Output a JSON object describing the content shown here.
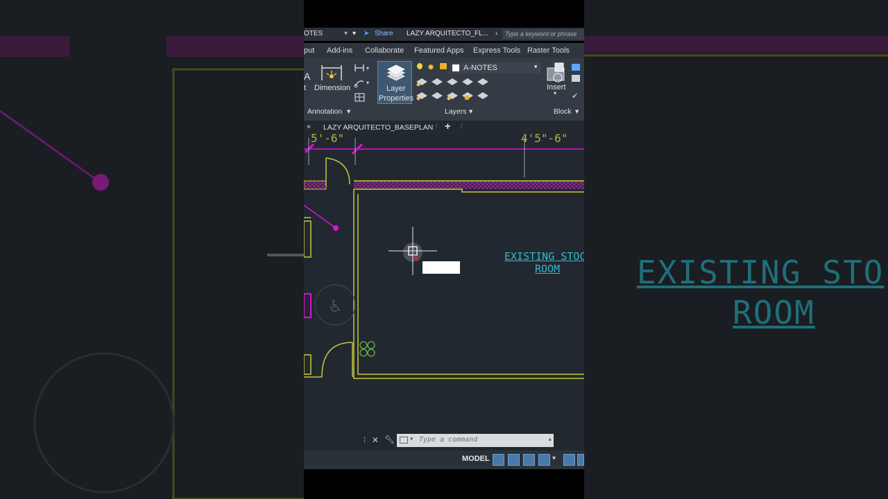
{
  "background": {
    "room_name_line1": "EXISTING STO",
    "room_name_line2": "ROOM"
  },
  "titlebar": {
    "workspace": "OTES",
    "share_label": "Share",
    "file_name": "LAZY ARQUITECTO_FL...",
    "search_placeholder": "Type a keyword or phrase"
  },
  "ribbon_tabs": [
    "put",
    "Add-ins",
    "Collaborate",
    "Featured Apps",
    "Express Tools",
    "Raster Tools"
  ],
  "ribbon": {
    "dimension_label": "Dimension",
    "layer_properties_line1": "Layer",
    "layer_properties_line2": "Properties",
    "current_layer": "A-NOTES",
    "insert_label": "Insert",
    "groups": {
      "annotation": "Annotation",
      "layers": "Layers",
      "block": "Block"
    }
  },
  "drawing_tab": {
    "name": "LAZY ARQUITECTO_BASEPLAN",
    "add_symbol": "+",
    "close_symbol": "×"
  },
  "canvas": {
    "room_label_line1": "EXISTING STOC",
    "room_label_line2": "ROOM",
    "dim_left": "5'-6\"",
    "dim_right": "4'5\"-6\""
  },
  "command": {
    "placeholder": "Type a command"
  },
  "status": {
    "model_label": "MODEL"
  },
  "colors": {
    "canvas_bg": "#212830",
    "wall": "#c8c83c",
    "magenta": "#e010d8",
    "cyan_text": "#35b9c8",
    "ribbon_bg": "#343b44"
  }
}
